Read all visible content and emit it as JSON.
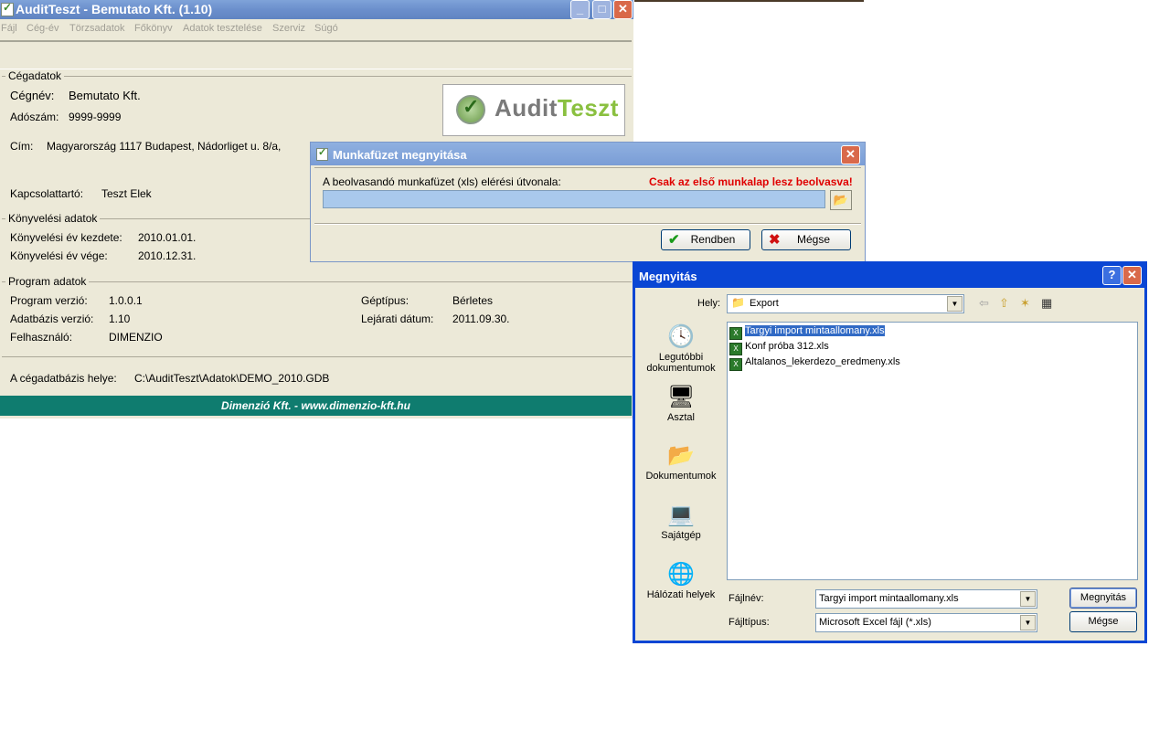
{
  "main": {
    "title": "AuditTeszt - Bemutato Kft.  (1.10)",
    "menu": [
      "Fájl",
      "Cég-év",
      "Törzsadatok",
      "Főkönyv",
      "Adatok tesztelése",
      "Szerviz",
      "Súgó"
    ],
    "sections": {
      "company": "Cégadatok",
      "accounting": "Könyvelési adatok",
      "program": "Program adatok"
    },
    "company": {
      "name_label": "Cégnév:",
      "name_value": "Bemutato Kft.",
      "tax_label": "Adószám:",
      "tax_value": "9999-9999",
      "address_label": "Cím:",
      "address_value": "Magyarország 1117 Budapest, Nádorliget u. 8/a,",
      "contact_label": "Kapcsolattartó:",
      "contact_value": "Teszt Elek"
    },
    "accounting": {
      "start_label": "Könyvelési év kezdete:",
      "start_value": "2010.01.01.",
      "end_label": "Könyvelési év vége:",
      "end_value": "2010.12.31."
    },
    "program": {
      "version_label": "Program verzió:",
      "version_value": "1.0.0.1",
      "db_label": "Adatbázis verzió:",
      "db_value": "1.10",
      "user_label": "Felhasználó:",
      "user_value": "DIMENZIO",
      "machine_label": "Géptípus:",
      "machine_value": "Bérletes",
      "expiry_label": "Lejárati dátum:",
      "expiry_value": "2011.09.30."
    },
    "db_path_label": "A cégadatbázis helye:",
    "db_path_value": "C:\\AuditTeszt\\Adatok\\DEMO_2010.GDB",
    "logo_part1": "Audit",
    "logo_part2": "Teszt",
    "footer": "Dimenzió Kft. - www.dimenzio-kft.hu"
  },
  "workbook_dialog": {
    "title": "Munkafüzet megnyitása",
    "path_label": "A beolvasandó munkafüzet (xls) elérési útvonala:",
    "warning": "Csak az első munkalap lesz beolvasva!",
    "path_value": "",
    "ok_label": "Rendben",
    "cancel_label": "Mégse"
  },
  "open_dialog": {
    "title": "Megnyitás",
    "location_label": "Hely:",
    "location_value": "Export",
    "places": [
      "Legutóbbi dokumentumok",
      "Asztal",
      "Dokumentumok",
      "Sajátgép",
      "Hálózati helyek"
    ],
    "files": [
      "Targyi import mintaallomany.xls",
      "Konf próba 312.xls",
      "Altalanos_lekerdezo_eredmeny.xls"
    ],
    "filename_label": "Fájlnév:",
    "filename_value": "Targyi import mintaallomany.xls",
    "filetype_label": "Fájltípus:",
    "filetype_value": "Microsoft Excel fájl (*.xls)",
    "open_label": "Megnyitás",
    "cancel_label": "Mégse"
  },
  "colors": {
    "footer_bg": "#0f7c6f",
    "warning_text": "#e00000",
    "xp_titlebar": "#0a46d4"
  }
}
